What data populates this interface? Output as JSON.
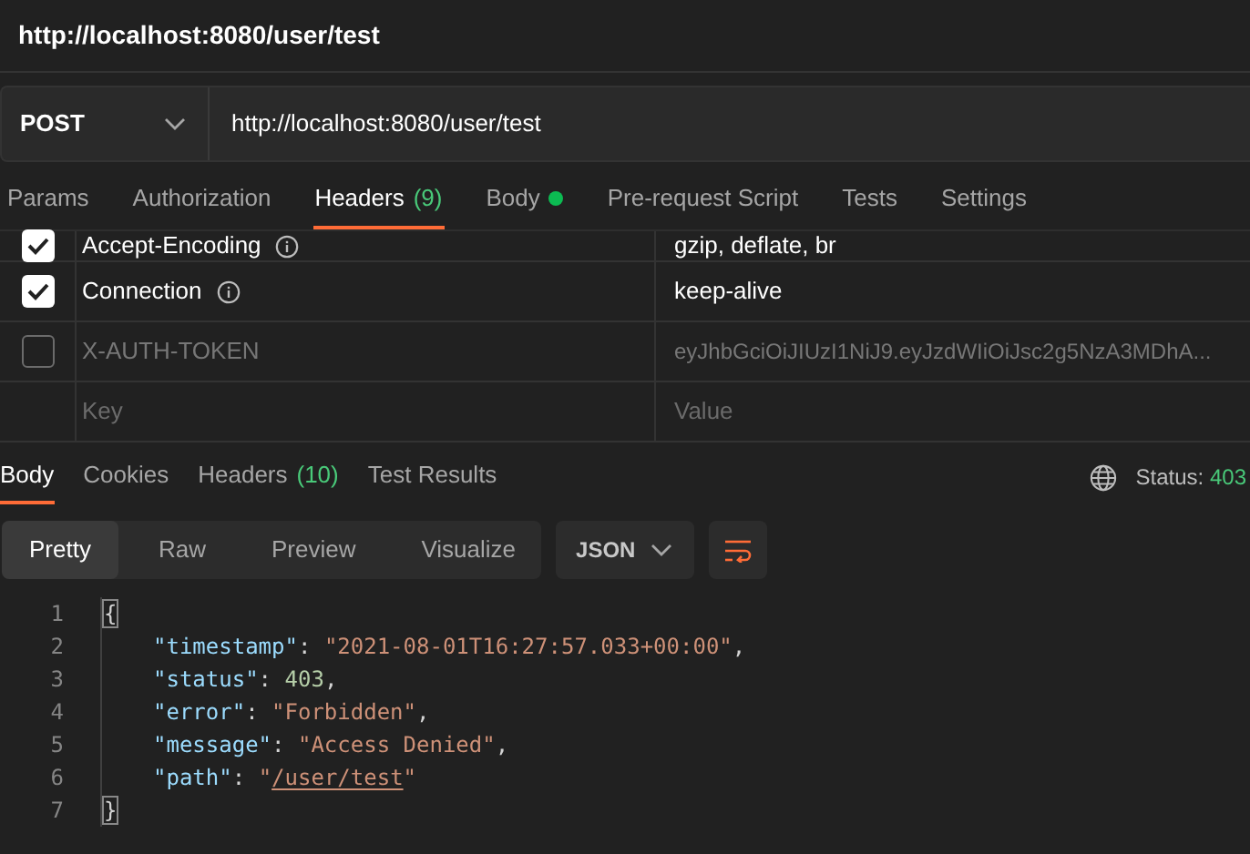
{
  "title": "http://localhost:8080/user/test",
  "request": {
    "method": "POST",
    "url": "http://localhost:8080/user/test"
  },
  "request_tabs": [
    {
      "label": "Params",
      "selected": false
    },
    {
      "label": "Authorization",
      "selected": false
    },
    {
      "label": "Headers",
      "count": "(9)",
      "selected": true
    },
    {
      "label": "Body",
      "dot": true,
      "selected": false
    },
    {
      "label": "Pre-request Script",
      "selected": false
    },
    {
      "label": "Tests",
      "selected": false
    },
    {
      "label": "Settings",
      "selected": false
    }
  ],
  "headers": [
    {
      "key": "Accept-Encoding",
      "info": true,
      "value": "gzip, deflate, br",
      "checked": true,
      "partial": true
    },
    {
      "key": "Connection",
      "info": true,
      "value": "keep-alive",
      "checked": true
    },
    {
      "key": "X-AUTH-TOKEN",
      "info": false,
      "value": "eyJhbGciOiJIUzI1NiJ9.eyJzdWIiOiJsc2g5NzA3MDhA...",
      "checked": false
    }
  ],
  "new_header": {
    "key_placeholder": "Key",
    "value_placeholder": "Value"
  },
  "response_tabs": [
    {
      "label": "Body",
      "selected": true
    },
    {
      "label": "Cookies",
      "selected": false
    },
    {
      "label": "Headers",
      "count": "(10)",
      "selected": false
    },
    {
      "label": "Test Results",
      "selected": false
    }
  ],
  "status": {
    "label": "Status:",
    "code": "403"
  },
  "view_modes": [
    {
      "label": "Pretty",
      "selected": true
    },
    {
      "label": "Raw",
      "selected": false
    },
    {
      "label": "Preview",
      "selected": false
    },
    {
      "label": "Visualize",
      "selected": false
    }
  ],
  "format": "JSON",
  "code_lines": [
    {
      "number": "1",
      "tokens": [
        {
          "kind": "brace",
          "text": "{"
        }
      ]
    },
    {
      "number": "2",
      "tokens": [
        {
          "kind": "key",
          "text": "\"timestamp\""
        },
        {
          "kind": "punct",
          "text": ": "
        },
        {
          "kind": "string",
          "text": "\"2021-08-01T16:27:57.033+00:00\""
        },
        {
          "kind": "punct",
          "text": ","
        }
      ]
    },
    {
      "number": "3",
      "tokens": [
        {
          "kind": "key",
          "text": "\"status\""
        },
        {
          "kind": "punct",
          "text": ": "
        },
        {
          "kind": "number",
          "text": "403"
        },
        {
          "kind": "punct",
          "text": ","
        }
      ]
    },
    {
      "number": "4",
      "tokens": [
        {
          "kind": "key",
          "text": "\"error\""
        },
        {
          "kind": "punct",
          "text": ": "
        },
        {
          "kind": "string",
          "text": "\"Forbidden\""
        },
        {
          "kind": "punct",
          "text": ","
        }
      ]
    },
    {
      "number": "5",
      "tokens": [
        {
          "kind": "key",
          "text": "\"message\""
        },
        {
          "kind": "punct",
          "text": ": "
        },
        {
          "kind": "string",
          "text": "\"Access Denied\""
        },
        {
          "kind": "punct",
          "text": ","
        }
      ]
    },
    {
      "number": "6",
      "tokens": [
        {
          "kind": "key",
          "text": "\"path\""
        },
        {
          "kind": "punct",
          "text": ": "
        },
        {
          "kind": "string",
          "text": "\""
        },
        {
          "kind": "link",
          "text": "/user/test"
        },
        {
          "kind": "string",
          "text": "\""
        }
      ]
    },
    {
      "number": "7",
      "tokens": [
        {
          "kind": "brace",
          "text": "}"
        }
      ]
    }
  ]
}
